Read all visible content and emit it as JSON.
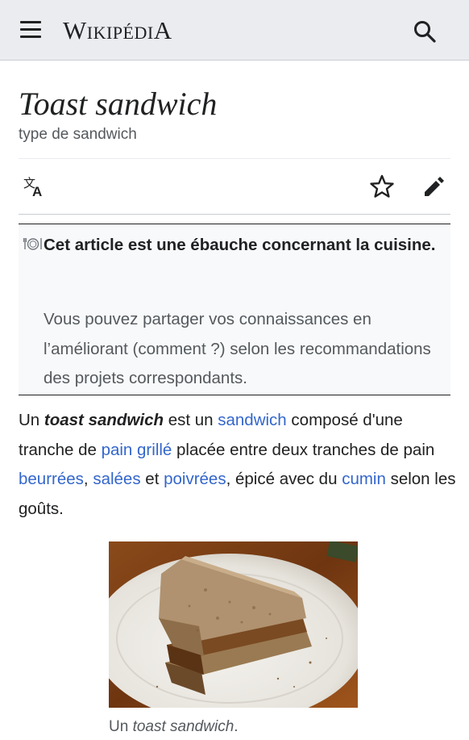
{
  "header": {
    "wordmark_cap_w": "W",
    "wordmark_mid": "IKIPÉDI",
    "wordmark_cap_a": "A",
    "menu_icon": "hamburger-icon",
    "search_icon": "search-icon"
  },
  "article": {
    "title": "Toast sandwich",
    "description": "type de sandwich"
  },
  "actions": {
    "language_icon": "language-icon",
    "watch_icon": "star-icon",
    "edit_icon": "pencil-icon"
  },
  "notice": {
    "icon": "cutlery-plate-icon",
    "title": "Cet article est une ébauche concernant la cuisine.",
    "body": "Vous pouvez partager vos connaissances en l’améliorant (comment ?) selon les recommandations des projets correspondants."
  },
  "lead": {
    "p1": "Un ",
    "term": "toast sandwich",
    "p2": " est un ",
    "link_sandwich": "sandwich",
    "p3": " composé d'une tranche de ",
    "link_pain_grille": "pain grillé",
    "p4": " placée entre deux tranches de pain ",
    "link_beurrees": "beurrées",
    "p5": ", ",
    "link_salees": "salées",
    "p6": " et ",
    "link_poivrees": "poivrées",
    "p7": ", épicé avec du ",
    "link_cumin": "cumin",
    "p8": " selon les goûts."
  },
  "figure": {
    "caption_prefix": "Un ",
    "caption_term": "toast sandwich",
    "caption_suffix": "."
  },
  "colors": {
    "link": "#3366cc",
    "header_bg": "#eaecf0",
    "notice_bg": "#f8f9fa"
  }
}
